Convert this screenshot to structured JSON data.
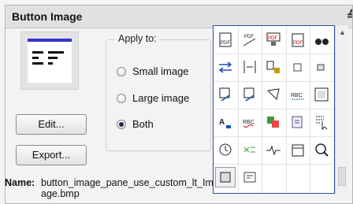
{
  "panel": {
    "title": "Button Image",
    "collapse_icon": "chevron-up-double-icon"
  },
  "apply_to": {
    "legend": "Apply to:",
    "options": [
      {
        "label": "Small image",
        "selected": false
      },
      {
        "label": "Large image",
        "selected": false
      },
      {
        "label": "Both",
        "selected": true
      }
    ]
  },
  "buttons": {
    "edit": "Edit...",
    "export": "Export..."
  },
  "name": {
    "label": "Name:",
    "value": "button_image_pane_use_custom_lt_Image.bmp"
  },
  "icon_grid": {
    "selected_index": 25,
    "icons": [
      "pdf-page-icon",
      "pdf-sign-icon",
      "pdf-stamp-icon",
      "pdf-export-icon",
      "binoculars-icon",
      "swap-arrows-icon",
      "align-arrows-icon",
      "text-lock-icon",
      "copy-small-icon",
      "stamp-small-icon",
      "edit-check-icon",
      "edit-check-arrow-icon",
      "select-shape-icon",
      "abc-text-icon",
      "frame-icon",
      "font-color-icon",
      "abc-spell-icon",
      "color-square-icon",
      "list-arrow-icon",
      "select-cursor-icon",
      "clock-icon",
      "link-shuffle-icon",
      "signal-line-icon",
      "calendar-icon",
      "magnifier-icon",
      "frame-selected-icon",
      "note-lines-icon",
      "empty-icon",
      "empty-icon",
      "empty-icon"
    ]
  }
}
